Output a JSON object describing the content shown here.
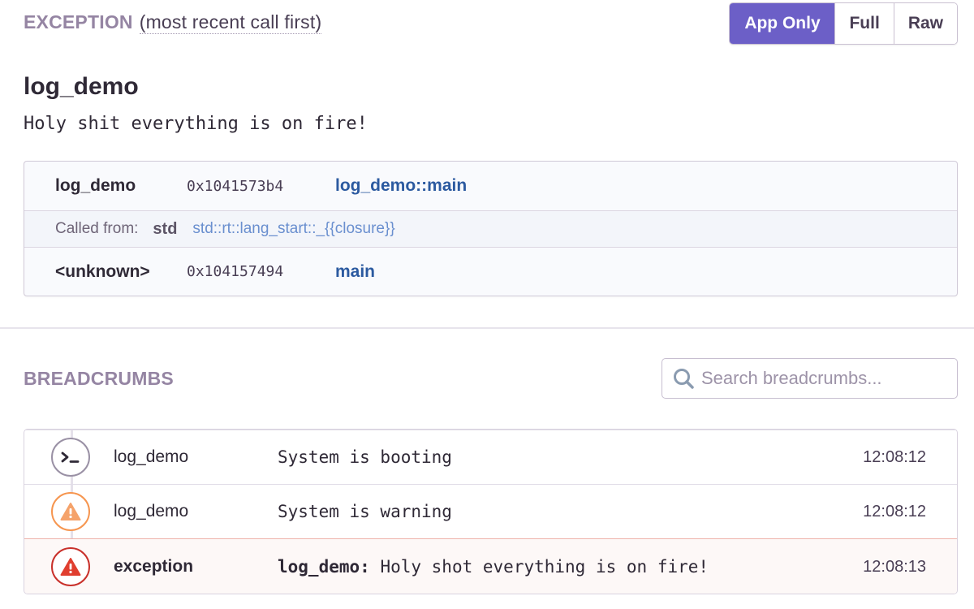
{
  "exception": {
    "title": "EXCEPTION",
    "subtitle": "(most recent call first)",
    "view_buttons": [
      {
        "label": "App Only",
        "active": true
      },
      {
        "label": "Full",
        "active": false
      },
      {
        "label": "Raw",
        "active": false
      }
    ],
    "type": "log_demo",
    "value": "Holy shit everything is on fire!",
    "frames": [
      {
        "package": "log_demo",
        "address": "0x1041573b4",
        "function": "log_demo::main"
      },
      {
        "called_from_label": "Called from:",
        "package": "std",
        "function": "std::rt::lang_start::_{{closure}}"
      },
      {
        "package": "<unknown>",
        "address": "0x104157494",
        "function": "main"
      }
    ]
  },
  "breadcrumbs": {
    "title": "BREADCRUMBS",
    "search": {
      "placeholder": "Search breadcrumbs...",
      "value": ""
    },
    "items": [
      {
        "icon": "terminal-icon",
        "category": "log_demo",
        "message": "System is booting",
        "time": "12:08:12",
        "level": "info"
      },
      {
        "icon": "warning-icon",
        "category": "log_demo",
        "message": "System is warning",
        "time": "12:08:12",
        "level": "warning"
      },
      {
        "icon": "error-icon",
        "category": "exception",
        "message_prefix": "log_demo:",
        "message": "Holy shot everything is on fire!",
        "time": "12:08:13",
        "level": "error"
      }
    ]
  },
  "colors": {
    "accent": "#6c5fc7",
    "link": "#2c5aa0",
    "warning": "#f6954f",
    "error": "#c9312b",
    "section_title": "#9585a3"
  }
}
